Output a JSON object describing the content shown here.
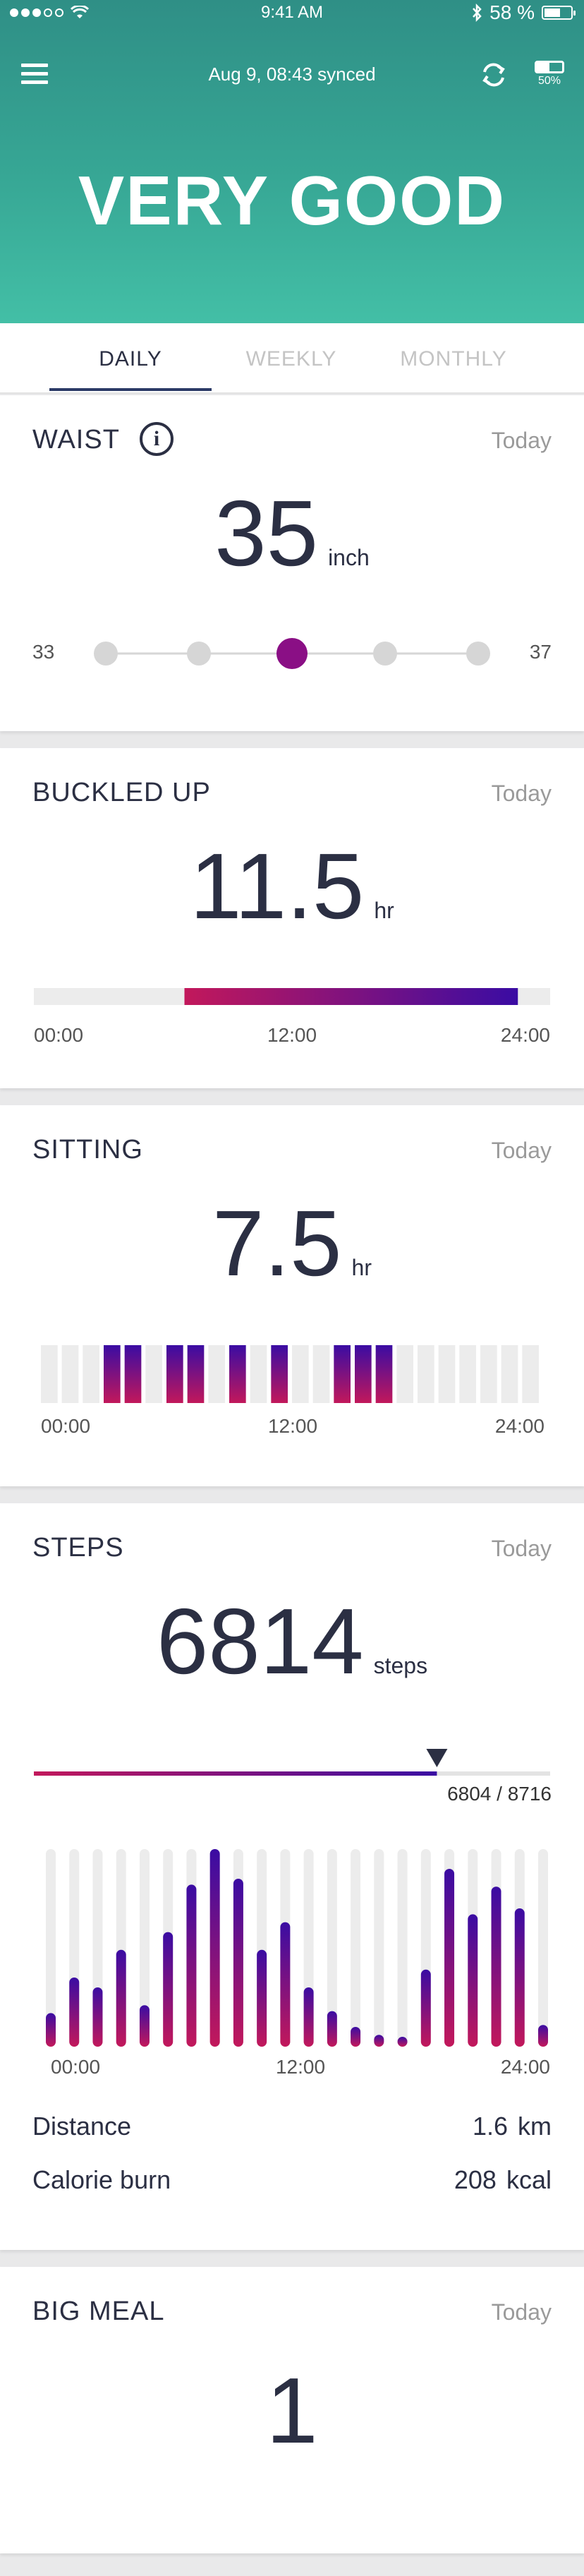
{
  "status_bar": {
    "time": "9:41 AM",
    "battery": "58 %"
  },
  "header": {
    "sync_text": "Aug 9, 08:43 synced",
    "device_battery": "50%",
    "device_battery_level": 0.5,
    "headline": "VERY GOOD"
  },
  "tabs": [
    {
      "label": "DAILY",
      "active": true
    },
    {
      "label": "WEEKLY",
      "active": false
    },
    {
      "label": "MONTHLY",
      "active": false
    }
  ],
  "waist": {
    "title": "WAIST",
    "date": "Today",
    "value": "35",
    "unit": "inch",
    "min_label": "33",
    "max_label": "37",
    "scale": [
      33,
      34,
      35,
      36,
      37
    ],
    "selected": 35
  },
  "buckled_up": {
    "title": "BUCKLED UP",
    "date": "Today",
    "value": "11.5",
    "unit": "hr",
    "range_start_hour": 7,
    "range_end_hour": 22.5,
    "ticks": [
      "00:00",
      "12:00",
      "24:00"
    ]
  },
  "sitting": {
    "title": "SITTING",
    "date": "Today",
    "value": "7.5",
    "unit": "hr",
    "hours_sitting": [
      0,
      0,
      0,
      1,
      1,
      0,
      1,
      1,
      0,
      1,
      0,
      1,
      0,
      0,
      1,
      1,
      1,
      0,
      0,
      0,
      0,
      0,
      0,
      0
    ],
    "ticks": [
      "00:00",
      "12:00",
      "24:00"
    ]
  },
  "steps": {
    "title": "STEPS",
    "date": "Today",
    "value": "6814",
    "unit": "steps",
    "progress_label": "6804 / 8716",
    "progress_value": 6804,
    "progress_goal": 8716,
    "hourly_levels": [
      0.17,
      0.35,
      0.3,
      0.49,
      0.21,
      0.58,
      0.82,
      1.0,
      0.85,
      0.49,
      0.63,
      0.3,
      0.18,
      0.1,
      0.06,
      0.05,
      0.39,
      0.9,
      0.67,
      0.81,
      0.7,
      0.11
    ],
    "ticks": [
      "00:00",
      "12:00",
      "24:00"
    ],
    "distance_label": "Distance",
    "distance_value": "1.6",
    "distance_unit": "km",
    "calorie_label": "Calorie burn",
    "calorie_value": "208",
    "calorie_unit": "kcal"
  },
  "big_meal": {
    "title": "BIG MEAL",
    "date": "Today",
    "value": "1"
  },
  "colors": {
    "accent_start": "#c2185b",
    "accent_end": "#3a0ca3",
    "teal": "#37a795"
  }
}
